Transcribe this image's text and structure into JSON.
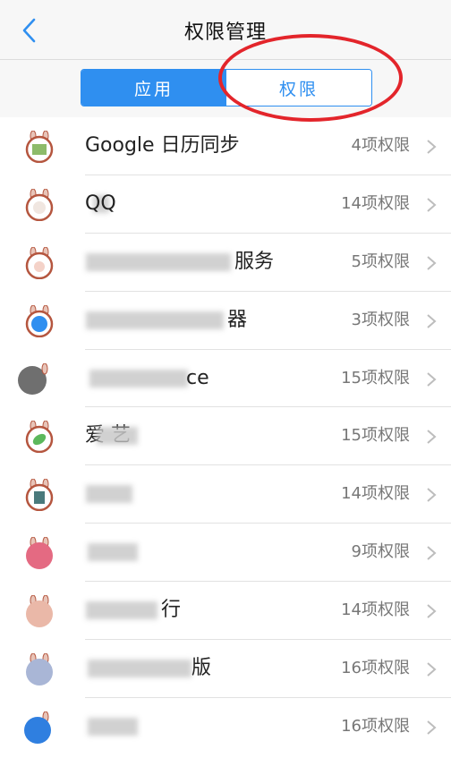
{
  "header": {
    "title": "权限管理",
    "back_icon": "chevron-left-icon"
  },
  "tabs": [
    {
      "label": "应用",
      "active": true
    },
    {
      "label": "权限",
      "active": false
    }
  ],
  "colors": {
    "accent": "#2f8ff0",
    "annotation": "#e3252b"
  },
  "apps": [
    {
      "name": "Google 日历同步",
      "permissions": "4项权限"
    },
    {
      "name": "QQ",
      "permissions": "14项权限"
    },
    {
      "name": "服务",
      "permissions": "5项权限"
    },
    {
      "name": "器",
      "permissions": "3项权限"
    },
    {
      "name": "ce",
      "permissions": "15项权限"
    },
    {
      "name": "爱 艺",
      "permissions": "15项权限"
    },
    {
      "name": "",
      "permissions": "14项权限"
    },
    {
      "name": "",
      "permissions": "9项权限"
    },
    {
      "name": "行",
      "permissions": "14项权限"
    },
    {
      "name": "版",
      "permissions": "16项权限"
    },
    {
      "name": "",
      "permissions": "16项权限"
    }
  ]
}
